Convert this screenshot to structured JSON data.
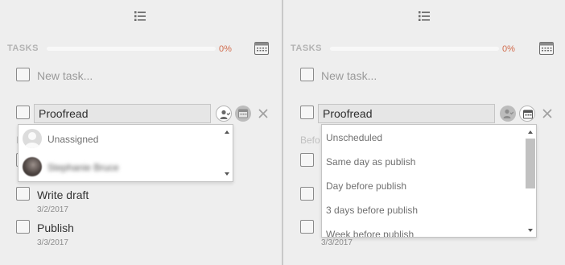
{
  "left": {
    "tasks_label": "TASKS",
    "progress_text": "0%",
    "progress_fraction": 0,
    "new_task_placeholder": "New task...",
    "editing_task_value": "Proofread",
    "section_fragment": "B",
    "assignee_dropdown": {
      "options": [
        {
          "label": "Unassigned",
          "avatar": "default-user-avatar"
        },
        {
          "label": "Stephanie Bruce",
          "avatar": "user-photo-avatar"
        }
      ]
    },
    "tasks": [
      {
        "title": "Write draft",
        "date": "3/2/2017"
      },
      {
        "title": "Publish",
        "date": "3/3/2017"
      }
    ]
  },
  "right": {
    "tasks_label": "TASKS",
    "progress_text": "0%",
    "progress_fraction": 0,
    "new_task_placeholder": "New task...",
    "editing_task_value": "Proofread",
    "section_fragment": "Befo",
    "schedule_dropdown": {
      "options": [
        "Unscheduled",
        "Same day as publish",
        "Day before publish",
        "3 days before publish",
        "Week before publish"
      ]
    },
    "visible_dates": [
      "3/3/2017"
    ]
  },
  "colors": {
    "accent": "#d45a3c",
    "panel_bg": "#eeeeee",
    "divider": "#c9c9c9"
  }
}
